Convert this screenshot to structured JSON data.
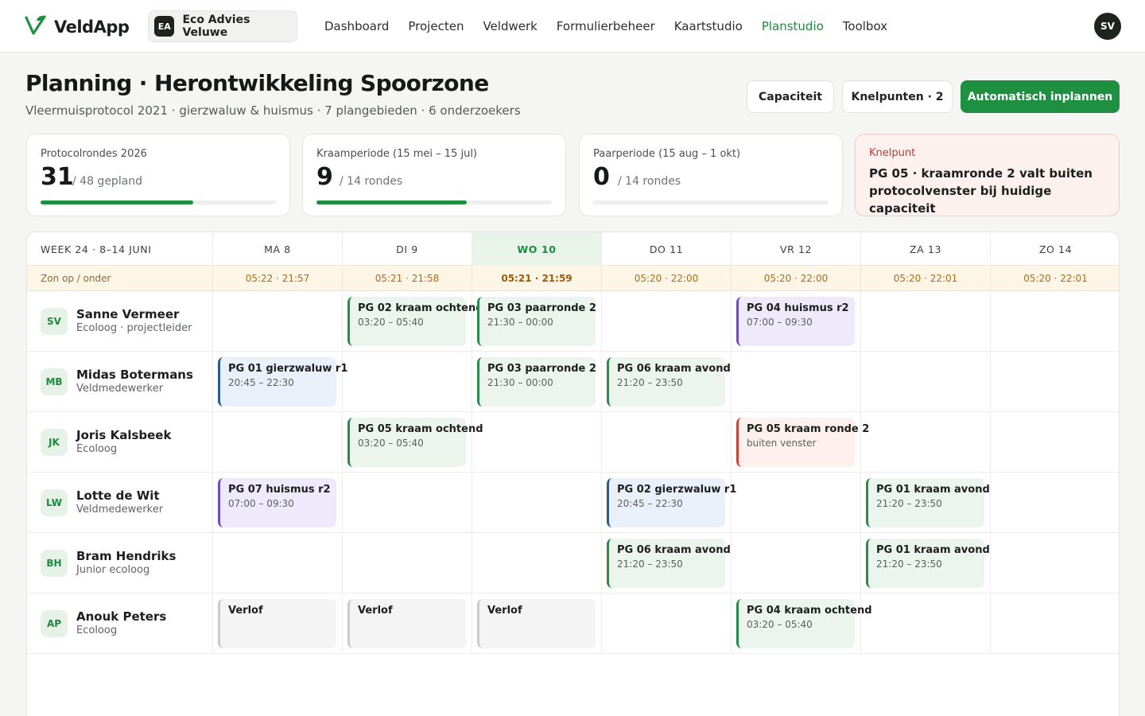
{
  "app": {
    "name": "VeldApp",
    "logo_icon": "v-leaf-logo-icon",
    "accent": "#1f8f42"
  },
  "org": {
    "initials": "EA",
    "name": "Eco Advies Veluwe"
  },
  "nav": {
    "items": [
      "Dashboard",
      "Projecten",
      "Veldwerk",
      "Formulierbeheer",
      "Kaartstudio",
      "Planstudio",
      "Toolbox"
    ],
    "active": "Planstudio"
  },
  "user": {
    "initials": "SV"
  },
  "header": {
    "title": "Planning · Herontwikkeling Spoorzone",
    "subtitle": "Vleermuisprotocol 2021 · gierzwaluw & huismus · 7 plangebieden · 6 onderzoekers",
    "buttons": {
      "capacity": "Capaciteit",
      "issues": "Knelpunten · 2",
      "auto": "Automatisch inplannen"
    }
  },
  "stats": [
    {
      "label": "Protocolrondes 2026",
      "value": "31",
      "of": "/ 48 gepland",
      "progress": 0.65
    },
    {
      "label": "Kraamperiode (15 mei – 15 jul)",
      "value": "9",
      "of": "/ 14 rondes",
      "progress": 0.64
    },
    {
      "label": "Paarperiode (15 aug – 1 okt)",
      "value": "0",
      "of": "/ 14 rondes",
      "progress": 0
    }
  ],
  "alert": {
    "label": "Knelpunt",
    "text": "PG 05 · kraamronde 2 valt buiten protocolvenster bij huidige capaciteit",
    "color": "#c2392e"
  },
  "calendar": {
    "week_label": "WEEK 24 · 8–14 JUNI",
    "sun_label": "Zon op / onder",
    "days": [
      {
        "label": "MA 8",
        "sun": "05:22 · 21:57",
        "today": false
      },
      {
        "label": "DI 9",
        "sun": "05:21 · 21:58",
        "today": false
      },
      {
        "label": "WO 10",
        "sun": "05:21 · 21:59",
        "today": true
      },
      {
        "label": "DO 11",
        "sun": "05:20 · 22:00",
        "today": false
      },
      {
        "label": "VR 12",
        "sun": "05:20 · 22:00",
        "today": false
      },
      {
        "label": "ZA 13",
        "sun": "05:20 · 22:01",
        "today": false
      },
      {
        "label": "ZO 14",
        "sun": "05:20 · 22:01",
        "today": false
      }
    ],
    "people": [
      {
        "initials": "SV",
        "name": "Sanne Vermeer",
        "role": "Ecoloog · projectleider",
        "events": [
          {
            "day": 1,
            "title": "PG 02 kraam ochtend",
            "time": "03:20 – 05:40",
            "kind": "green"
          },
          {
            "day": 2,
            "title": "PG 03 paarronde 2",
            "time": "21:30 – 00:00",
            "kind": "green"
          },
          {
            "day": 4,
            "title": "PG 04 huismus r2",
            "time": "07:00 – 09:30",
            "kind": "purple"
          }
        ]
      },
      {
        "initials": "MB",
        "name": "Midas Botermans",
        "role": "Veldmedewerker",
        "events": [
          {
            "day": 0,
            "title": "PG 01 gierzwaluw r1",
            "time": "20:45 – 22:30",
            "kind": "blue"
          },
          {
            "day": 2,
            "title": "PG 03 paarronde 2",
            "time": "21:30 – 00:00",
            "kind": "green"
          },
          {
            "day": 3,
            "title": "PG 06 kraam avond",
            "time": "21:20 – 23:50",
            "kind": "green"
          }
        ]
      },
      {
        "initials": "JK",
        "name": "Joris Kalsbeek",
        "role": "Ecoloog",
        "events": [
          {
            "day": 1,
            "title": "PG 05 kraam ochtend",
            "time": "03:20 – 05:40",
            "kind": "green"
          },
          {
            "day": 4,
            "title": "PG 05 kraam ronde 2",
            "time": "buiten venster",
            "kind": "red"
          }
        ]
      },
      {
        "initials": "LW",
        "name": "Lotte de Wit",
        "role": "Veldmedewerker",
        "events": [
          {
            "day": 0,
            "title": "PG 07 huismus r2",
            "time": "07:00 – 09:30",
            "kind": "purple"
          },
          {
            "day": 3,
            "title": "PG 02 gierzwaluw r1",
            "time": "20:45 – 22:30",
            "kind": "blue"
          },
          {
            "day": 5,
            "title": "PG 01 kraam avond",
            "time": "21:20 – 23:50",
            "kind": "green"
          }
        ]
      },
      {
        "initials": "BH",
        "name": "Bram Hendriks",
        "role": "Junior ecoloog",
        "events": [
          {
            "day": 3,
            "title": "PG 06 kraam avond",
            "time": "21:20 – 23:50",
            "kind": "green"
          },
          {
            "day": 5,
            "title": "PG 01 kraam avond",
            "time": "21:20 – 23:50",
            "kind": "green"
          }
        ]
      },
      {
        "initials": "AP",
        "name": "Anouk Peters",
        "role": "Ecoloog",
        "events": [
          {
            "day": 0,
            "title": "Verlof",
            "time": "",
            "kind": "gray"
          },
          {
            "day": 1,
            "title": "Verlof",
            "time": "",
            "kind": "gray"
          },
          {
            "day": 2,
            "title": "Verlof",
            "time": "",
            "kind": "gray"
          },
          {
            "day": 4,
            "title": "PG 04 kraam ochtend",
            "time": "03:20 – 05:40",
            "kind": "green"
          }
        ]
      }
    ]
  }
}
